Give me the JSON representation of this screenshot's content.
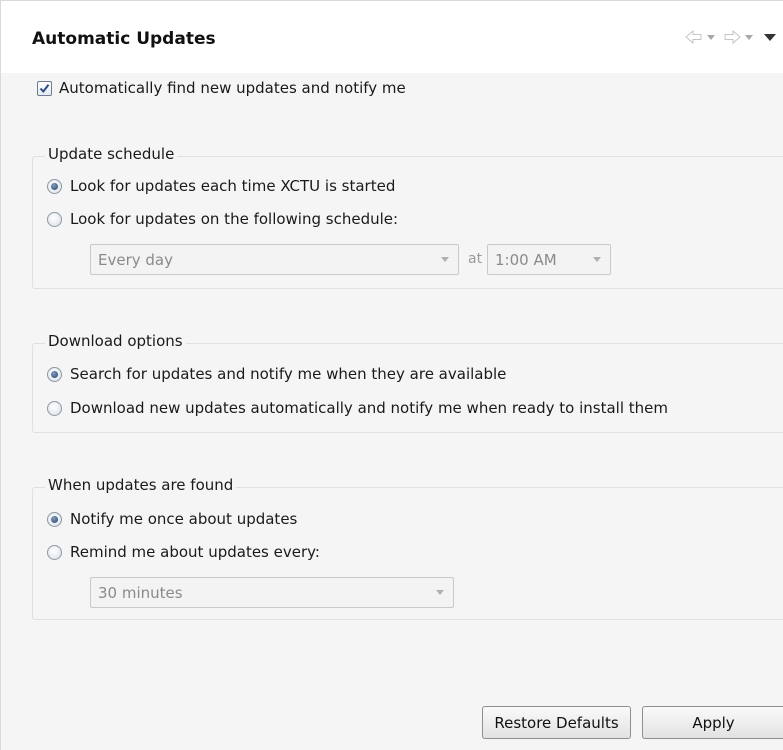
{
  "header": {
    "title": "Automatic Updates",
    "nav": {
      "back_icon": "back-arrow-icon",
      "forward_icon": "forward-arrow-icon",
      "menu_icon": "view-menu-icon"
    }
  },
  "auto_find": {
    "label": "Automatically find new updates and notify me",
    "checked": true
  },
  "update_schedule": {
    "legend": "Update schedule",
    "options": [
      {
        "label": "Look for updates each time XCTU is started",
        "selected": true
      },
      {
        "label": "Look for updates on the following schedule:",
        "selected": false
      }
    ],
    "day_select": {
      "value": "Every day",
      "enabled": false
    },
    "at_label": "at",
    "time_select": {
      "value": "1:00 AM",
      "enabled": false
    }
  },
  "download_options": {
    "legend": "Download options",
    "options": [
      {
        "label": "Search for updates and notify me when they are available",
        "selected": true
      },
      {
        "label": "Download new updates automatically and notify me when ready to install them",
        "selected": false
      }
    ]
  },
  "when_found": {
    "legend": "When updates are found",
    "options": [
      {
        "label": "Notify me once about updates",
        "selected": true
      },
      {
        "label": "Remind me about updates every:",
        "selected": false
      }
    ],
    "remind_select": {
      "value": "30 minutes",
      "enabled": false
    }
  },
  "buttons": {
    "restore_defaults": "Restore Defaults",
    "apply": "Apply"
  }
}
